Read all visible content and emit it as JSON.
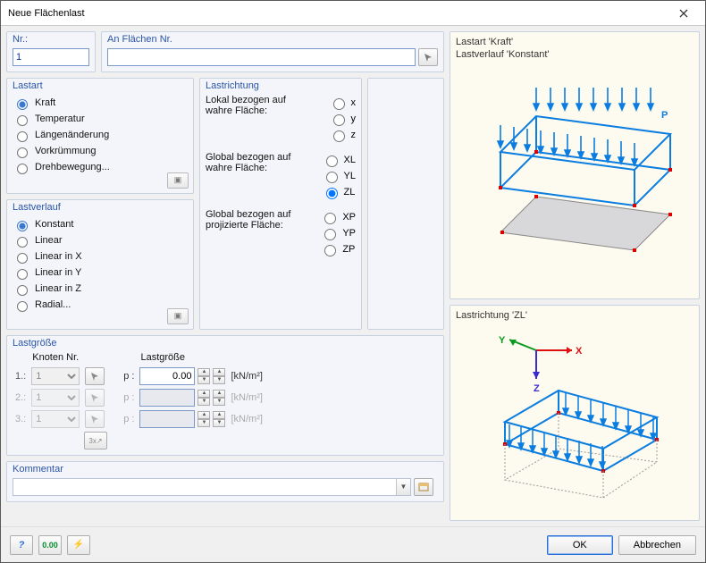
{
  "window": {
    "title": "Neue Flächenlast"
  },
  "nr": {
    "legend": "Nr.:",
    "value": "1"
  },
  "an": {
    "legend": "An Flächen Nr.",
    "value": ""
  },
  "lastart": {
    "legend": "Lastart",
    "options": [
      "Kraft",
      "Temperatur",
      "Längenänderung",
      "Vorkrümmung",
      "Drehbewegung..."
    ],
    "selected": "Kraft"
  },
  "lastverlauf": {
    "legend": "Lastverlauf",
    "options": [
      "Konstant",
      "Linear",
      "Linear in X",
      "Linear in Y",
      "Linear in Z",
      "Radial..."
    ],
    "selected": "Konstant"
  },
  "lastrichtung": {
    "legend": "Lastrichtung",
    "groups": [
      {
        "label": "Lokal bezogen auf wahre Fläche:",
        "options": [
          "x",
          "y",
          "z"
        ]
      },
      {
        "label": "Global bezogen auf wahre Fläche:",
        "options": [
          "XL",
          "YL",
          "ZL"
        ]
      },
      {
        "label": "Global bezogen auf projizierte Fläche:",
        "options": [
          "XP",
          "YP",
          "ZP"
        ]
      }
    ],
    "selected": "ZL"
  },
  "lastgroesse": {
    "legend": "Lastgröße",
    "col_node": "Knoten Nr.",
    "col_mag": "Lastgröße",
    "rows": [
      {
        "idx": "1.:",
        "node": "1",
        "label": "p :",
        "value": "0.00",
        "unit": "[kN/m²]",
        "enabled": true
      },
      {
        "idx": "2.:",
        "node": "1",
        "label": "p :",
        "value": "",
        "unit": "[kN/m²]",
        "enabled": false
      },
      {
        "idx": "3.:",
        "node": "1",
        "label": "p :",
        "value": "",
        "unit": "[kN/m²]",
        "enabled": false
      }
    ]
  },
  "kommentar": {
    "legend": "Kommentar",
    "value": ""
  },
  "preview1": {
    "line1": "Lastart 'Kraft'",
    "line2": "Lastverlauf 'Konstant'",
    "p_label": "P"
  },
  "preview2": {
    "line1": "Lastrichtung 'ZL'",
    "ax_x": "X",
    "ax_y": "Y",
    "ax_z": "Z"
  },
  "footer": {
    "ok": "OK",
    "cancel": "Abbrechen"
  }
}
